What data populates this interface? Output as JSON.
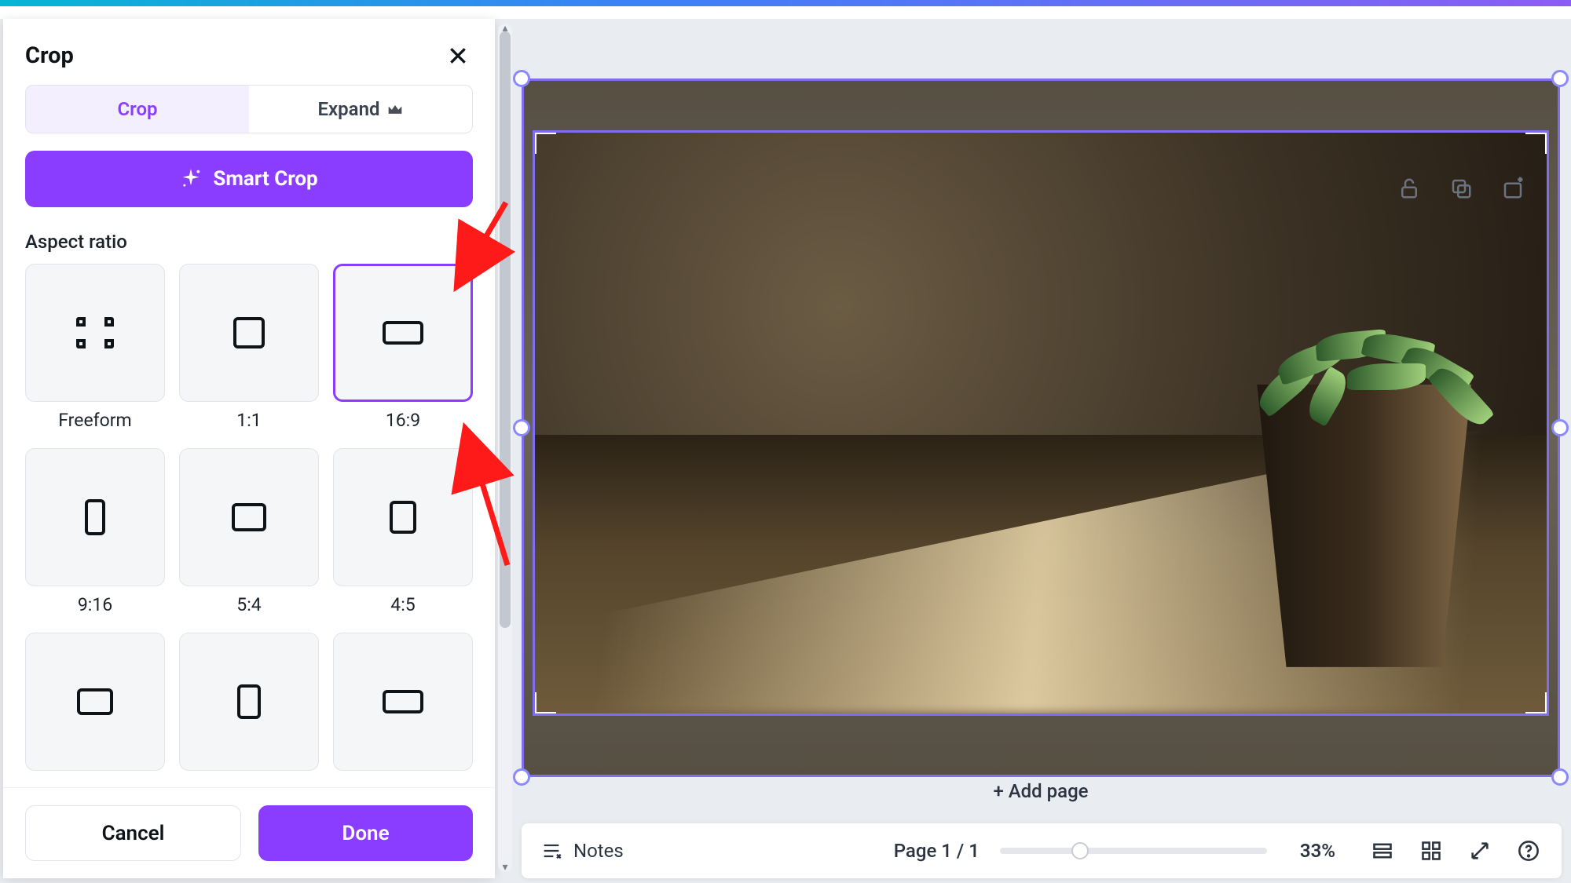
{
  "panel": {
    "title": "Crop",
    "tabs": {
      "crop": "Crop",
      "expand": "Expand"
    },
    "smart_crop": "Smart Crop",
    "section_label": "Aspect ratio",
    "ratios": [
      {
        "key": "freeform",
        "label": "Freeform"
      },
      {
        "key": "1:1",
        "label": "1:1"
      },
      {
        "key": "16:9",
        "label": "16:9",
        "selected": true
      },
      {
        "key": "9:16",
        "label": "9:16"
      },
      {
        "key": "5:4",
        "label": "5:4"
      },
      {
        "key": "4:5",
        "label": "4:5"
      },
      {
        "key": "r7",
        "label": ""
      },
      {
        "key": "r8",
        "label": ""
      },
      {
        "key": "r9",
        "label": ""
      }
    ],
    "cancel": "Cancel",
    "done": "Done"
  },
  "canvas": {
    "add_page": "+ Add page"
  },
  "footer": {
    "notes": "Notes",
    "page_counter": "Page 1 / 1",
    "zoom_pct": "33%"
  },
  "colors": {
    "accent": "#8b3dff"
  }
}
